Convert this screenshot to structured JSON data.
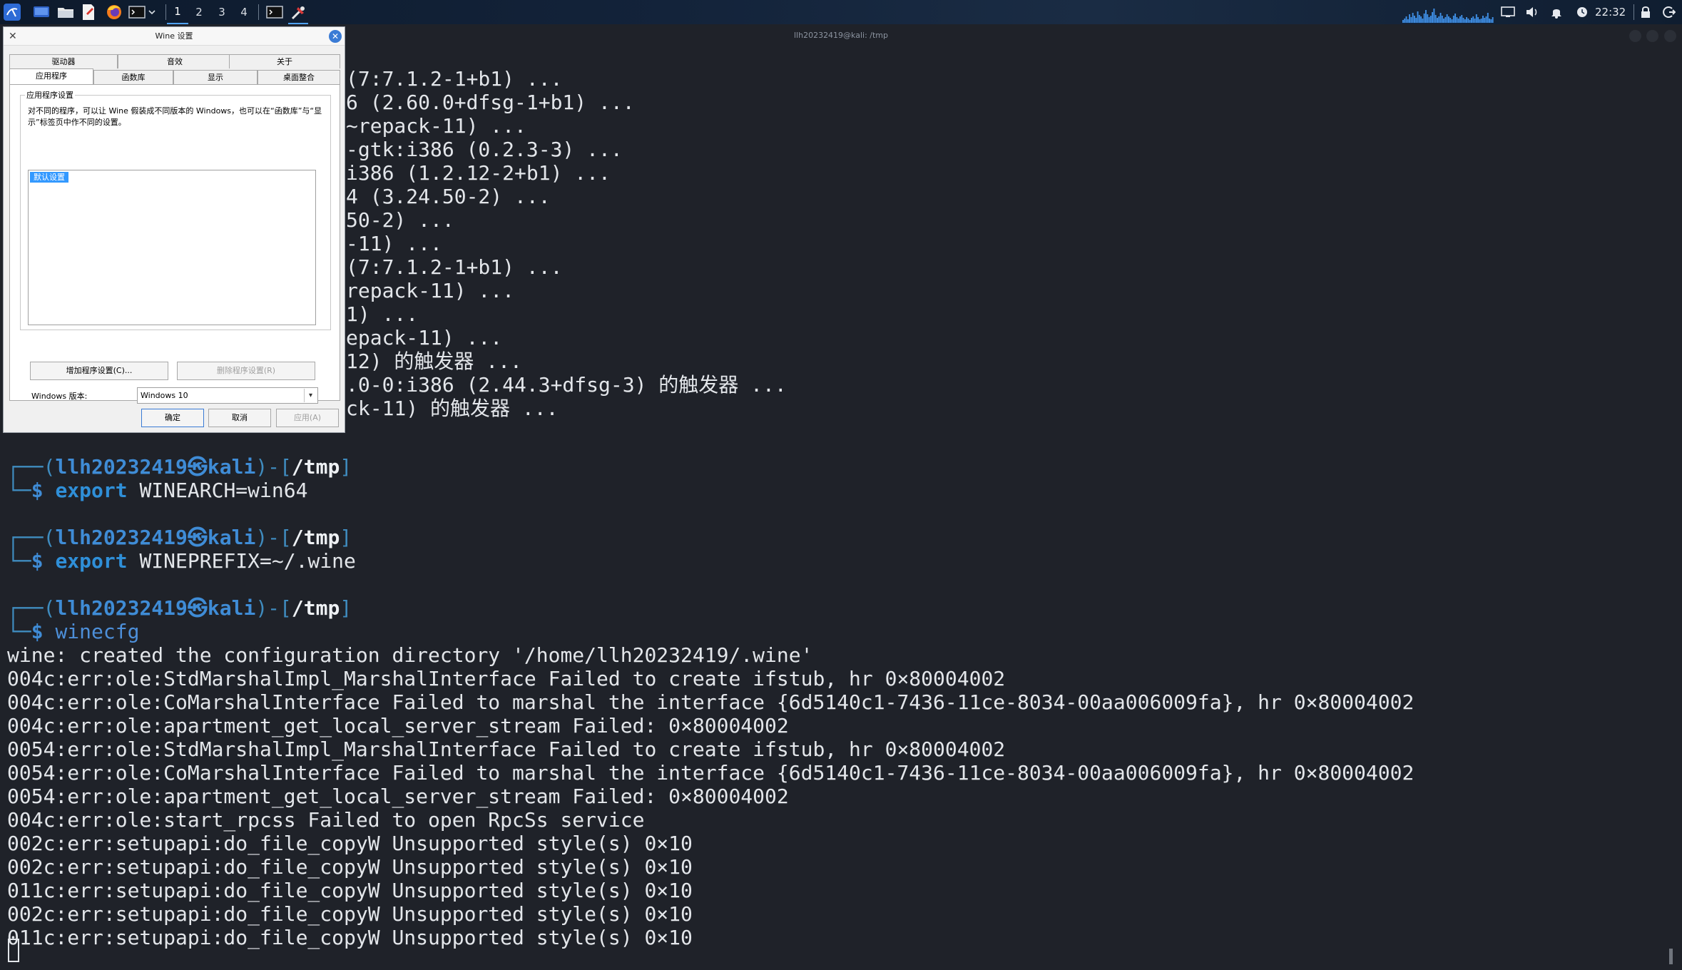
{
  "taskbar": {
    "workspaces": [
      "1",
      "2",
      "3",
      "4"
    ],
    "active_workspace": "1",
    "clock": "22:32",
    "colors": {
      "accent": "#4fa3ff",
      "graph": "#3f8fe6"
    }
  },
  "terminal": {
    "title": "llh20232419@kali: /tmp",
    "fragments": [
      "(7:7.1.2-1+b1) ...",
      "6 (2.60.0+dfsg-1+b1) ...",
      "~repack-11) ...",
      "-gtk:i386 (0.2.3-3) ...",
      "i386 (1.2.12-2+b1) ...",
      "4 (3.24.50-2) ...",
      "50-2) ...",
      "-11) ...",
      "(7:7.1.2-1+b1) ...",
      "repack-11) ...",
      "1) ...",
      "epack-11) ...",
      "12) 的触发器 ...",
      ".0-0:i386 (2.44.3+dfsg-3) 的触发器 ...",
      "ck-11) 的触发器 ..."
    ],
    "prompts": [
      {
        "user": "llh20232419",
        "host": "kali",
        "path": "/tmp",
        "cmd_keyword": "export",
        "cmd_rest": " WINEARCH=win64"
      },
      {
        "user": "llh20232419",
        "host": "kali",
        "path": "/tmp",
        "cmd_keyword": "export",
        "cmd_rest": " WINEPREFIX=~/.wine"
      },
      {
        "user": "llh20232419",
        "host": "kali",
        "path": "/tmp",
        "cmd_keyword": "",
        "cmd_rest": "winecfg"
      }
    ],
    "output": [
      "wine: created the configuration directory '/home/llh20232419/.wine'",
      "004c:err:ole:StdMarshalImpl_MarshalInterface Failed to create ifstub, hr 0×80004002",
      "004c:err:ole:CoMarshalInterface Failed to marshal the interface {6d5140c1-7436-11ce-8034-00aa006009fa}, hr 0×80004002",
      "004c:err:ole:apartment_get_local_server_stream Failed: 0×80004002",
      "0054:err:ole:StdMarshalImpl_MarshalInterface Failed to create ifstub, hr 0×80004002",
      "0054:err:ole:CoMarshalInterface Failed to marshal the interface {6d5140c1-7436-11ce-8034-00aa006009fa}, hr 0×80004002",
      "0054:err:ole:apartment_get_local_server_stream Failed: 0×80004002",
      "004c:err:ole:start_rpcss Failed to open RpcSs service",
      "002c:err:setupapi:do_file_copyW Unsupported style(s) 0×10",
      "002c:err:setupapi:do_file_copyW Unsupported style(s) 0×10",
      "011c:err:setupapi:do_file_copyW Unsupported style(s) 0×10",
      "002c:err:setupapi:do_file_copyW Unsupported style(s) 0×10",
      "011c:err:setupapi:do_file_copyW Unsupported style(s) 0×10"
    ]
  },
  "wine_dialog": {
    "title": "Wine 设置",
    "tabs_row1": [
      "驱动器",
      "音效",
      "关于"
    ],
    "tabs_row2": [
      "应用程序",
      "函数库",
      "显示",
      "桌面整合"
    ],
    "active_tab": "应用程序",
    "group_label": "应用程序设置",
    "description": "对不同的程序，可以让 Wine 假装成不同版本的 Windows，也可以在“函数库”与“显示”标签页中作不同的设置。",
    "list_items": [
      "默认设置"
    ],
    "add_button": "增加程序设置(C)...",
    "remove_button": "删除程序设置(R)",
    "version_label": "Windows 版本:",
    "version_value": "Windows 10",
    "ok_button": "确定",
    "cancel_button": "取消",
    "apply_button": "应用(A)"
  }
}
